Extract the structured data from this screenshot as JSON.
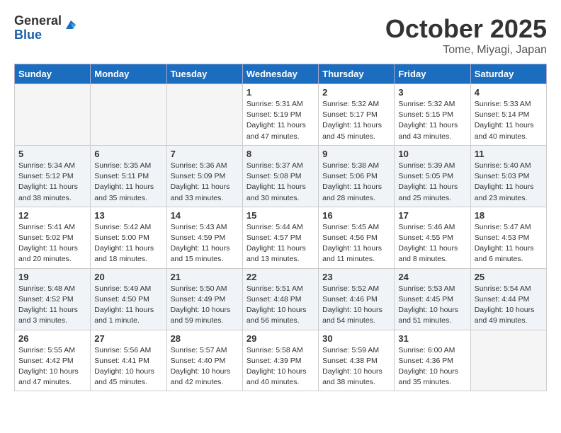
{
  "header": {
    "logo_general": "General",
    "logo_blue": "Blue",
    "month_title": "October 2025",
    "location": "Tome, Miyagi, Japan"
  },
  "days_of_week": [
    "Sunday",
    "Monday",
    "Tuesday",
    "Wednesday",
    "Thursday",
    "Friday",
    "Saturday"
  ],
  "weeks": [
    [
      {
        "num": "",
        "info": "",
        "empty": true
      },
      {
        "num": "",
        "info": "",
        "empty": true
      },
      {
        "num": "",
        "info": "",
        "empty": true
      },
      {
        "num": "1",
        "info": "Sunrise: 5:31 AM\nSunset: 5:19 PM\nDaylight: 11 hours\nand 47 minutes.",
        "empty": false
      },
      {
        "num": "2",
        "info": "Sunrise: 5:32 AM\nSunset: 5:17 PM\nDaylight: 11 hours\nand 45 minutes.",
        "empty": false
      },
      {
        "num": "3",
        "info": "Sunrise: 5:32 AM\nSunset: 5:15 PM\nDaylight: 11 hours\nand 43 minutes.",
        "empty": false
      },
      {
        "num": "4",
        "info": "Sunrise: 5:33 AM\nSunset: 5:14 PM\nDaylight: 11 hours\nand 40 minutes.",
        "empty": false
      }
    ],
    [
      {
        "num": "5",
        "info": "Sunrise: 5:34 AM\nSunset: 5:12 PM\nDaylight: 11 hours\nand 38 minutes.",
        "empty": false
      },
      {
        "num": "6",
        "info": "Sunrise: 5:35 AM\nSunset: 5:11 PM\nDaylight: 11 hours\nand 35 minutes.",
        "empty": false
      },
      {
        "num": "7",
        "info": "Sunrise: 5:36 AM\nSunset: 5:09 PM\nDaylight: 11 hours\nand 33 minutes.",
        "empty": false
      },
      {
        "num": "8",
        "info": "Sunrise: 5:37 AM\nSunset: 5:08 PM\nDaylight: 11 hours\nand 30 minutes.",
        "empty": false
      },
      {
        "num": "9",
        "info": "Sunrise: 5:38 AM\nSunset: 5:06 PM\nDaylight: 11 hours\nand 28 minutes.",
        "empty": false
      },
      {
        "num": "10",
        "info": "Sunrise: 5:39 AM\nSunset: 5:05 PM\nDaylight: 11 hours\nand 25 minutes.",
        "empty": false
      },
      {
        "num": "11",
        "info": "Sunrise: 5:40 AM\nSunset: 5:03 PM\nDaylight: 11 hours\nand 23 minutes.",
        "empty": false
      }
    ],
    [
      {
        "num": "12",
        "info": "Sunrise: 5:41 AM\nSunset: 5:02 PM\nDaylight: 11 hours\nand 20 minutes.",
        "empty": false
      },
      {
        "num": "13",
        "info": "Sunrise: 5:42 AM\nSunset: 5:00 PM\nDaylight: 11 hours\nand 18 minutes.",
        "empty": false
      },
      {
        "num": "14",
        "info": "Sunrise: 5:43 AM\nSunset: 4:59 PM\nDaylight: 11 hours\nand 15 minutes.",
        "empty": false
      },
      {
        "num": "15",
        "info": "Sunrise: 5:44 AM\nSunset: 4:57 PM\nDaylight: 11 hours\nand 13 minutes.",
        "empty": false
      },
      {
        "num": "16",
        "info": "Sunrise: 5:45 AM\nSunset: 4:56 PM\nDaylight: 11 hours\nand 11 minutes.",
        "empty": false
      },
      {
        "num": "17",
        "info": "Sunrise: 5:46 AM\nSunset: 4:55 PM\nDaylight: 11 hours\nand 8 minutes.",
        "empty": false
      },
      {
        "num": "18",
        "info": "Sunrise: 5:47 AM\nSunset: 4:53 PM\nDaylight: 11 hours\nand 6 minutes.",
        "empty": false
      }
    ],
    [
      {
        "num": "19",
        "info": "Sunrise: 5:48 AM\nSunset: 4:52 PM\nDaylight: 11 hours\nand 3 minutes.",
        "empty": false
      },
      {
        "num": "20",
        "info": "Sunrise: 5:49 AM\nSunset: 4:50 PM\nDaylight: 11 hours\nand 1 minute.",
        "empty": false
      },
      {
        "num": "21",
        "info": "Sunrise: 5:50 AM\nSunset: 4:49 PM\nDaylight: 10 hours\nand 59 minutes.",
        "empty": false
      },
      {
        "num": "22",
        "info": "Sunrise: 5:51 AM\nSunset: 4:48 PM\nDaylight: 10 hours\nand 56 minutes.",
        "empty": false
      },
      {
        "num": "23",
        "info": "Sunrise: 5:52 AM\nSunset: 4:46 PM\nDaylight: 10 hours\nand 54 minutes.",
        "empty": false
      },
      {
        "num": "24",
        "info": "Sunrise: 5:53 AM\nSunset: 4:45 PM\nDaylight: 10 hours\nand 51 minutes.",
        "empty": false
      },
      {
        "num": "25",
        "info": "Sunrise: 5:54 AM\nSunset: 4:44 PM\nDaylight: 10 hours\nand 49 minutes.",
        "empty": false
      }
    ],
    [
      {
        "num": "26",
        "info": "Sunrise: 5:55 AM\nSunset: 4:42 PM\nDaylight: 10 hours\nand 47 minutes.",
        "empty": false
      },
      {
        "num": "27",
        "info": "Sunrise: 5:56 AM\nSunset: 4:41 PM\nDaylight: 10 hours\nand 45 minutes.",
        "empty": false
      },
      {
        "num": "28",
        "info": "Sunrise: 5:57 AM\nSunset: 4:40 PM\nDaylight: 10 hours\nand 42 minutes.",
        "empty": false
      },
      {
        "num": "29",
        "info": "Sunrise: 5:58 AM\nSunset: 4:39 PM\nDaylight: 10 hours\nand 40 minutes.",
        "empty": false
      },
      {
        "num": "30",
        "info": "Sunrise: 5:59 AM\nSunset: 4:38 PM\nDaylight: 10 hours\nand 38 minutes.",
        "empty": false
      },
      {
        "num": "31",
        "info": "Sunrise: 6:00 AM\nSunset: 4:36 PM\nDaylight: 10 hours\nand 35 minutes.",
        "empty": false
      },
      {
        "num": "",
        "info": "",
        "empty": true
      }
    ]
  ]
}
